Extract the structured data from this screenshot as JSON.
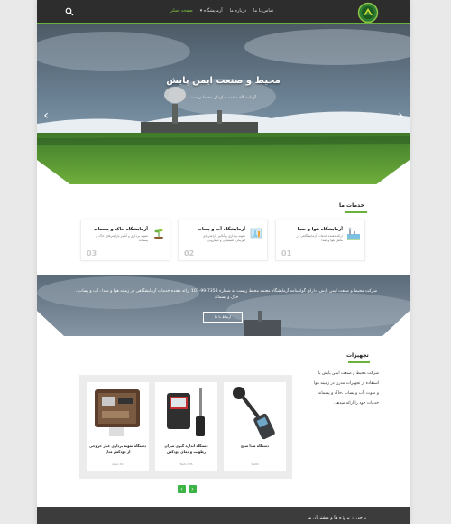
{
  "header": {
    "nav": [
      {
        "label": "صفحه اصلی",
        "active": true
      },
      {
        "label": "آزمایشگاه ▾",
        "active": false
      },
      {
        "label": "درباره ما",
        "active": false
      },
      {
        "label": "تماس با ما",
        "active": false
      }
    ],
    "icons": {
      "search": "search-icon",
      "logo": "company-logo"
    },
    "accent": "#6ab23d"
  },
  "hero": {
    "title": "محیط و صنعت ایمن پایش",
    "subtitle": "آزمایشگاه معتمد سازمان محیط زیست"
  },
  "services": {
    "heading": "خدمات ما",
    "cards": [
      {
        "title": "آزمایشگاه هوا و صدا",
        "desc": "ارائه دهنده خدمات آزمایشگاهی در بخش هوا و صدا",
        "num": "01",
        "icon": "factory-icon"
      },
      {
        "title": "آزمایشگاه آب و پساب",
        "desc": "نمونه برداری و آنالیز پارامترهای فیزیکی، شیمیایی و میکروبی",
        "num": "02",
        "icon": "water-lab-icon"
      },
      {
        "title": "آزمایشگاه خاک و پسماند",
        "desc": "نمونه برداری و آنالیز پارامترهای خاک و پسماند",
        "num": "03",
        "icon": "plant-icon"
      }
    ]
  },
  "banner": {
    "text": "شرکت محیط و صنعت ایمن پایش، دارای گواهینامه آزمایشگاه معتمد محیط زیست به شماره 7358-99-101 ارائه دهنده خدمات آزمایشگاهی در زمینه هوا و صدا ، آب و پساب ، خاک و پسماند",
    "button": "ارتباط با ما"
  },
  "equipment": {
    "heading": "تجهیزات",
    "text": "شرکت محیط و صنعت ایمن پایش با استفاده از تجهیزات مدرن در زمینه هوا و صوت ،آب و پساب ،خاک و پسماند خدمات خود را ارائه میدهد.",
    "products": [
      {
        "name": "دستگاه صدا سنج",
        "sub": "SVAN",
        "icon": "sound-level-meter-icon"
      },
      {
        "name": "دستگاه اندازه گیری میزان رطوبت و دمای دودکش",
        "sub": "Testo 635",
        "icon": "humidity-meter-icon"
      },
      {
        "name": "دستگاه نمونه برداری غبار خروجی از دودکش مدل",
        "sub": "Apex XC",
        "icon": "dust-sampler-icon"
      }
    ],
    "pager": {
      "prev": "‹",
      "next": "›"
    }
  },
  "footer": {
    "text": "برخی از پروژه ها و مشتریان ما"
  }
}
